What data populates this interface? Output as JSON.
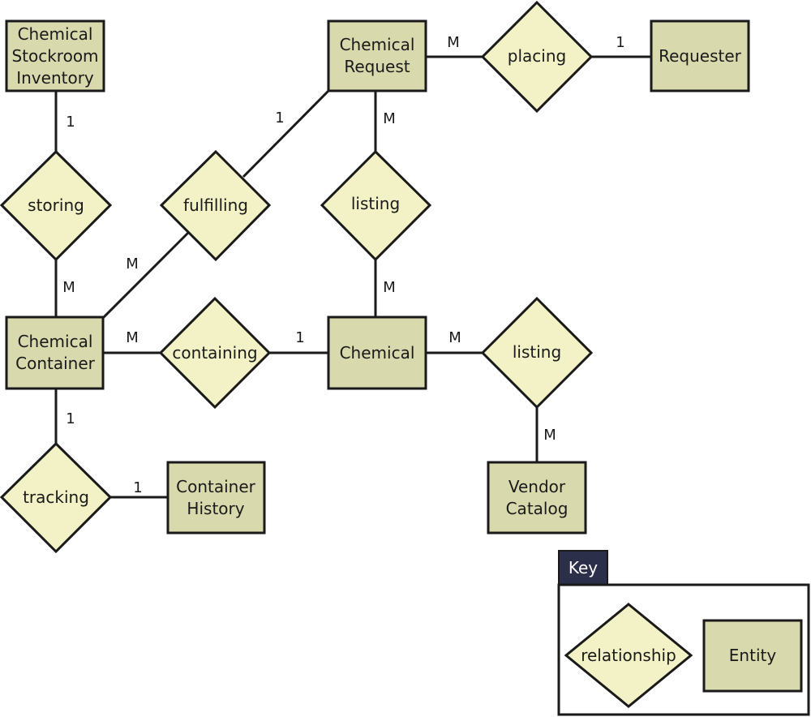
{
  "entities": {
    "inventory": [
      "Chemical",
      "Stockroom",
      "Inventory"
    ],
    "request": [
      "Chemical",
      "Request"
    ],
    "requester": [
      "Requester"
    ],
    "container": [
      "Chemical",
      "Container"
    ],
    "chemical": [
      "Chemical"
    ],
    "history": [
      "Container",
      "History"
    ],
    "vendor": [
      "Vendor",
      "Catalog"
    ]
  },
  "relationships": {
    "storing": "storing",
    "fulfilling": "fulfilling",
    "listing_request": "listing",
    "placing": "placing",
    "containing": "containing",
    "listing_vendor": "listing",
    "tracking": "tracking"
  },
  "cardinalities": {
    "inventory_storing": "1",
    "storing_container": "M",
    "request_fulfilling": "1",
    "fulfilling_container": "M",
    "request_placing": "M",
    "placing_requester": "1",
    "request_listing": "M",
    "listing_chemical": "M",
    "container_containing": "M",
    "containing_chemical": "1",
    "chemical_listing": "M",
    "listing_vendor": "M",
    "container_tracking": "1",
    "tracking_history": "1"
  },
  "key": {
    "title": "Key",
    "relationship": "relationship",
    "entity": "Entity"
  }
}
